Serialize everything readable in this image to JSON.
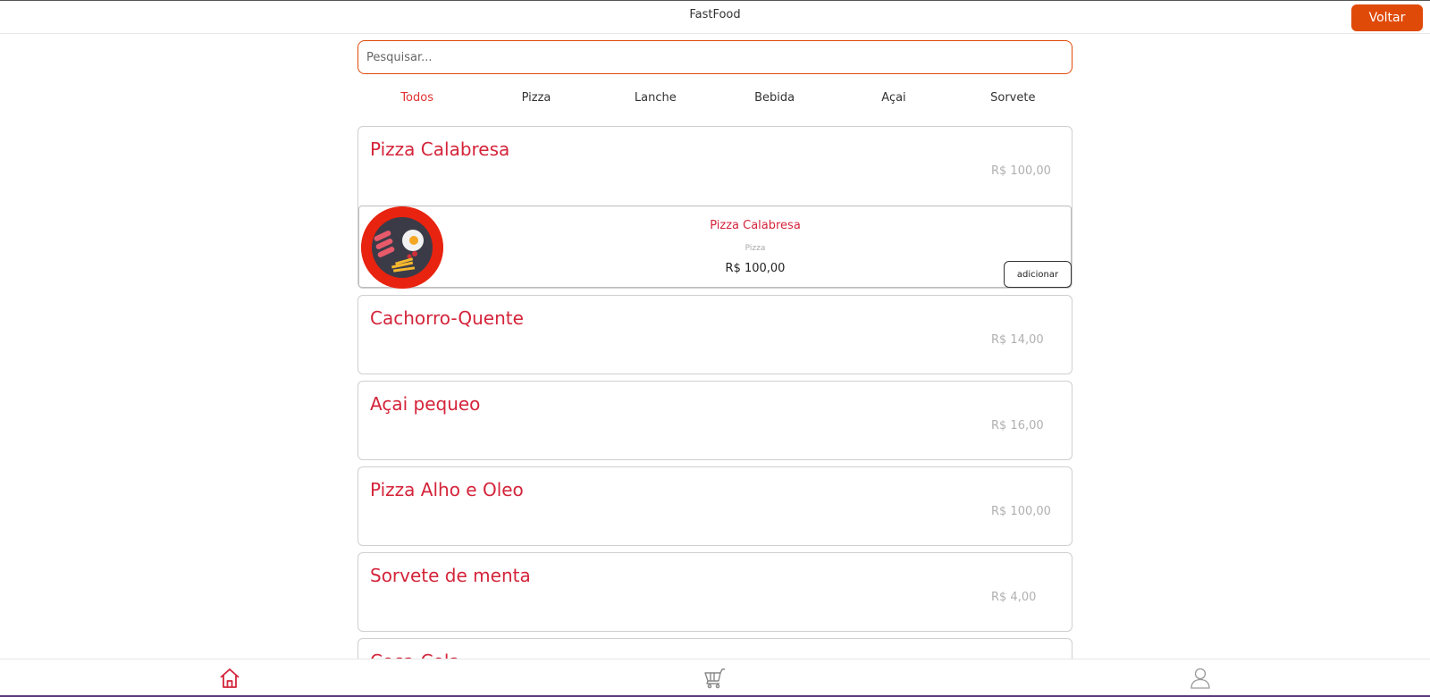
{
  "header": {
    "title": "FastFood",
    "back_label": "Voltar"
  },
  "search": {
    "placeholder": "Pesquisar...",
    "value": ""
  },
  "categories": [
    "Todos",
    "Pizza",
    "Lanche",
    "Bebida",
    "Açai",
    "Sorvete"
  ],
  "active_category": "Todos",
  "products": [
    {
      "name": "Pizza Calabresa",
      "price": "R$ 100,00"
    },
    {
      "name": "Cachorro-Quente",
      "price": "R$ 14,00"
    },
    {
      "name": "Açai pequeo",
      "price": "R$ 16,00"
    },
    {
      "name": "Pizza Alho e Oleo",
      "price": "R$ 100,00"
    },
    {
      "name": "Sorvete de menta",
      "price": "R$ 4,00"
    },
    {
      "name": "Coca-Cola",
      "price": ""
    }
  ],
  "expanded_product": {
    "name": "Pizza Calabresa",
    "category": "Pizza",
    "price": "R$ 100,00",
    "add_label": "adicionar",
    "image_icon": "food-plate-icon"
  },
  "bottom_nav": {
    "home_icon": "home-icon",
    "cart_icon": "cart-icon",
    "profile_icon": "user-icon"
  },
  "colors": {
    "accent": "#e04a08",
    "product_name": "#d4243a",
    "active_tab": "#e03030",
    "price_muted": "#b0b0b0"
  }
}
